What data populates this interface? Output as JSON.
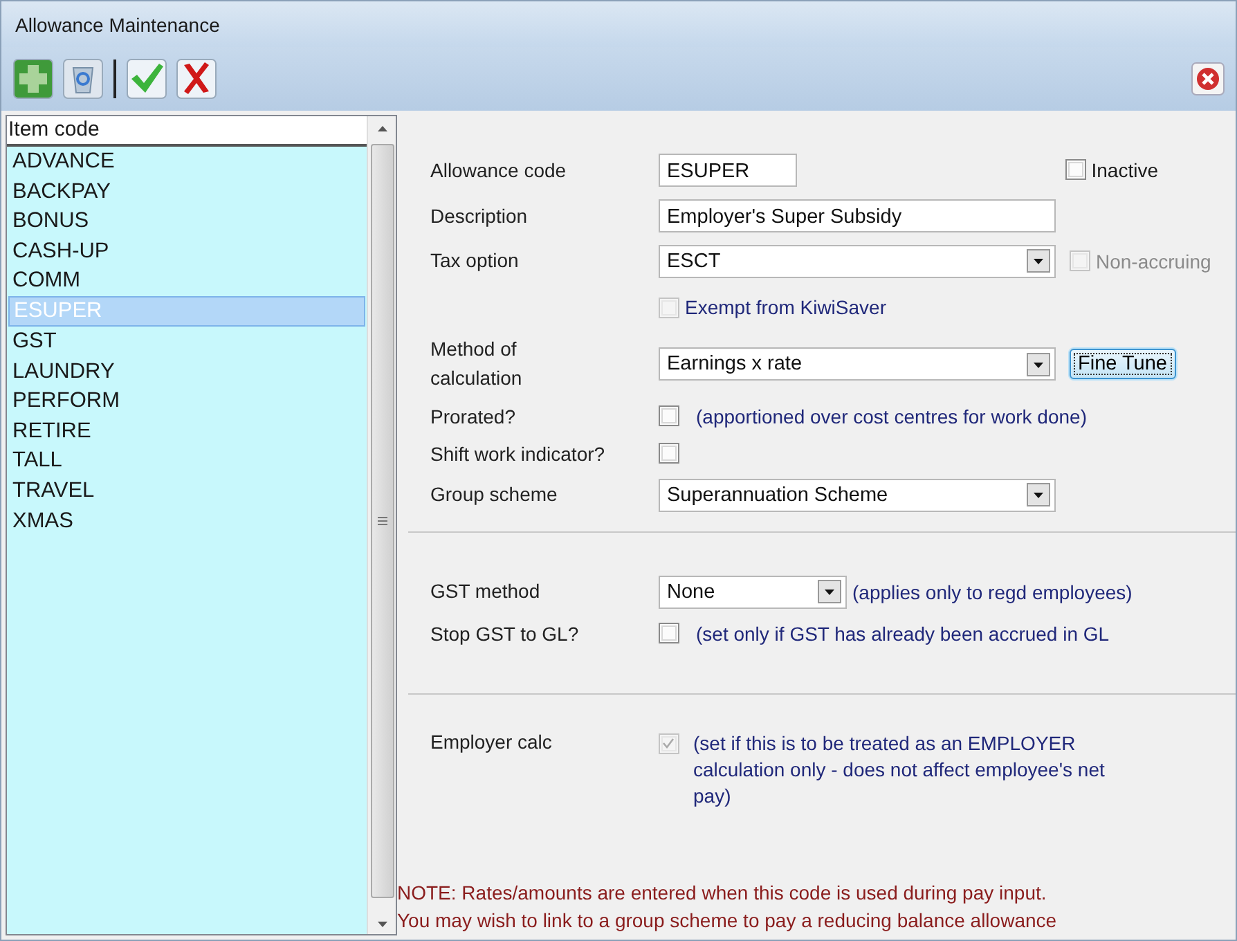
{
  "window": {
    "title": "Allowance Maintenance"
  },
  "toolbar": [
    {
      "kind": "add"
    },
    {
      "kind": "delete"
    },
    {
      "kind": "separator"
    },
    {
      "kind": "save"
    },
    {
      "kind": "cancel"
    },
    {
      "kind": "close"
    }
  ],
  "list": {
    "header": "Item code",
    "items": [
      {
        "label": "ADVANCE",
        "selected": false
      },
      {
        "label": "BACKPAY",
        "selected": false
      },
      {
        "label": "BONUS",
        "selected": false
      },
      {
        "label": "CASH-UP",
        "selected": false
      },
      {
        "label": "COMM",
        "selected": false
      },
      {
        "label": "ESUPER",
        "selected": true
      },
      {
        "label": "GST",
        "selected": false
      },
      {
        "label": "LAUNDRY",
        "selected": false
      },
      {
        "label": "PERFORM",
        "selected": false
      },
      {
        "label": "RETIRE",
        "selected": false
      },
      {
        "label": "TALL",
        "selected": false
      },
      {
        "label": "TRAVEL",
        "selected": false
      },
      {
        "label": "XMAS",
        "selected": false
      }
    ]
  },
  "form": {
    "sections": [
      {
        "rows": [
          {
            "kind": "text",
            "label": "Allowance code",
            "value": "ESUPER",
            "side": {
              "label": "Inactive",
              "checked": false,
              "disabled": false
            }
          },
          {
            "kind": "text",
            "label": "Description",
            "value": "Employer's Super Subsidy"
          },
          {
            "kind": "select",
            "label": "Tax option",
            "value": "ESCT",
            "side": {
              "label": "Non-accruing",
              "checked": false,
              "disabled": true
            }
          },
          {
            "kind": "check",
            "checked": false,
            "disabled": true,
            "hint": "Exempt from KiwiSaver"
          },
          {
            "kind": "select",
            "label": "Method of calculation",
            "value": "Earnings x rate",
            "button": "Fine Tune"
          },
          {
            "kind": "check",
            "label": "Prorated?",
            "checked": false,
            "disabled": false,
            "hint": "(apportioned over cost centres for work done)"
          },
          {
            "kind": "check",
            "label": "Shift work indicator?",
            "checked": false,
            "disabled": false
          },
          {
            "kind": "select",
            "label": "Group scheme",
            "value": "Superannuation Scheme"
          }
        ]
      },
      {
        "rows": [
          {
            "kind": "select",
            "label": "GST method",
            "value": "None",
            "hint": "(applies only to regd employees)"
          },
          {
            "kind": "check",
            "label": "Stop GST to GL?",
            "checked": false,
            "disabled": false,
            "hint": "(set only if GST has already been accrued in GL"
          }
        ]
      },
      {
        "rows": [
          {
            "kind": "check",
            "label": "Employer calc",
            "checked": true,
            "disabled": true,
            "hint": "(set if this is to be treated as an EMPLOYER calculation only - does not affect employee's net pay)"
          }
        ]
      }
    ],
    "note": [
      "NOTE: Rates/amounts are entered when this code is used during pay input.",
      "You may wish to link to a group scheme to pay a reducing balance allowance"
    ]
  }
}
